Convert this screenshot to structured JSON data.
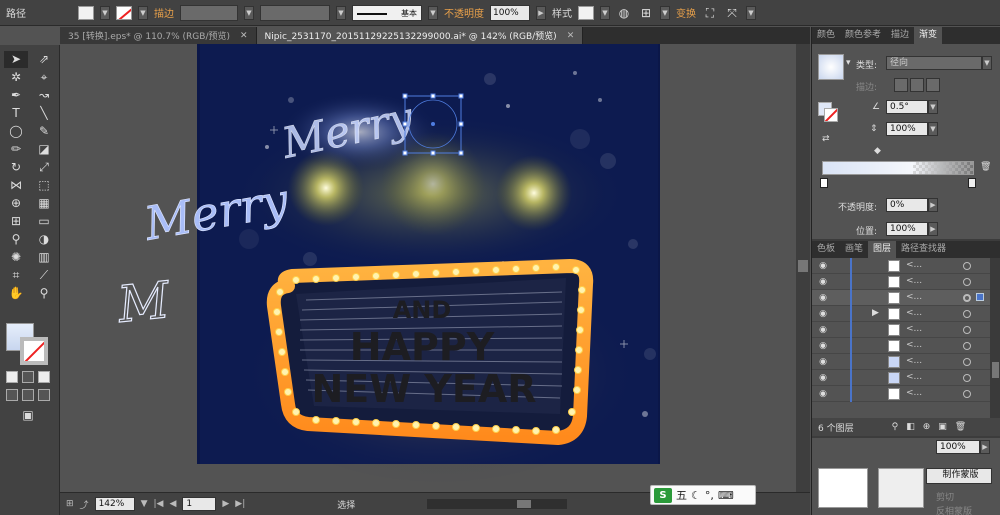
{
  "controlbar": {
    "selection": "路径",
    "stroke_label": "描边",
    "stroke_style": "基本",
    "opacity_label": "不透明度",
    "opacity_value": "100%",
    "style_label": "样式",
    "transform_label": "变换"
  },
  "tabs": [
    {
      "label": "35 [转换].eps* @ 110.7% (RGB/预览)"
    },
    {
      "label": "Nipic_2531170_20151129225132299000.ai* @ 142% (RGB/预览)"
    }
  ],
  "canvas": {
    "artboard_bg": "#0b1748",
    "title_and": "AND",
    "title_happy": "HAPPY",
    "title_new_year": "NEW YEAR",
    "merry_top": "Merry",
    "merry_left": "Merry",
    "letter_m": "M"
  },
  "statusbar": {
    "zoom": "142%",
    "page": "1",
    "status_text": "选择"
  },
  "ime": {
    "logo": "S",
    "label": "五"
  },
  "panels": {
    "top_tabs": [
      "颜色",
      "颜色参考",
      "描边",
      "渐变"
    ],
    "gradient": {
      "type_label": "类型:",
      "type_value": "径向",
      "stroke_label": "描边:",
      "angle_value": "0.5°",
      "aspect_value": "100%",
      "opacity_label": "不透明度:",
      "opacity_value": "0%",
      "location_label": "位置:",
      "location_value": "100%"
    },
    "layers_tabs": [
      "色板",
      "画笔",
      "图层",
      "路径查找器"
    ],
    "layers_rows": [
      "<...",
      "<...",
      "<...",
      "<...",
      "<...",
      "<...",
      "<...",
      "<...",
      "<..."
    ],
    "layers_count": "6 个图层",
    "transparency": {
      "opacity_value": "100%",
      "mask_button": "制作蒙版",
      "clip_label": "剪切",
      "invert_label": "反相蒙版"
    }
  }
}
